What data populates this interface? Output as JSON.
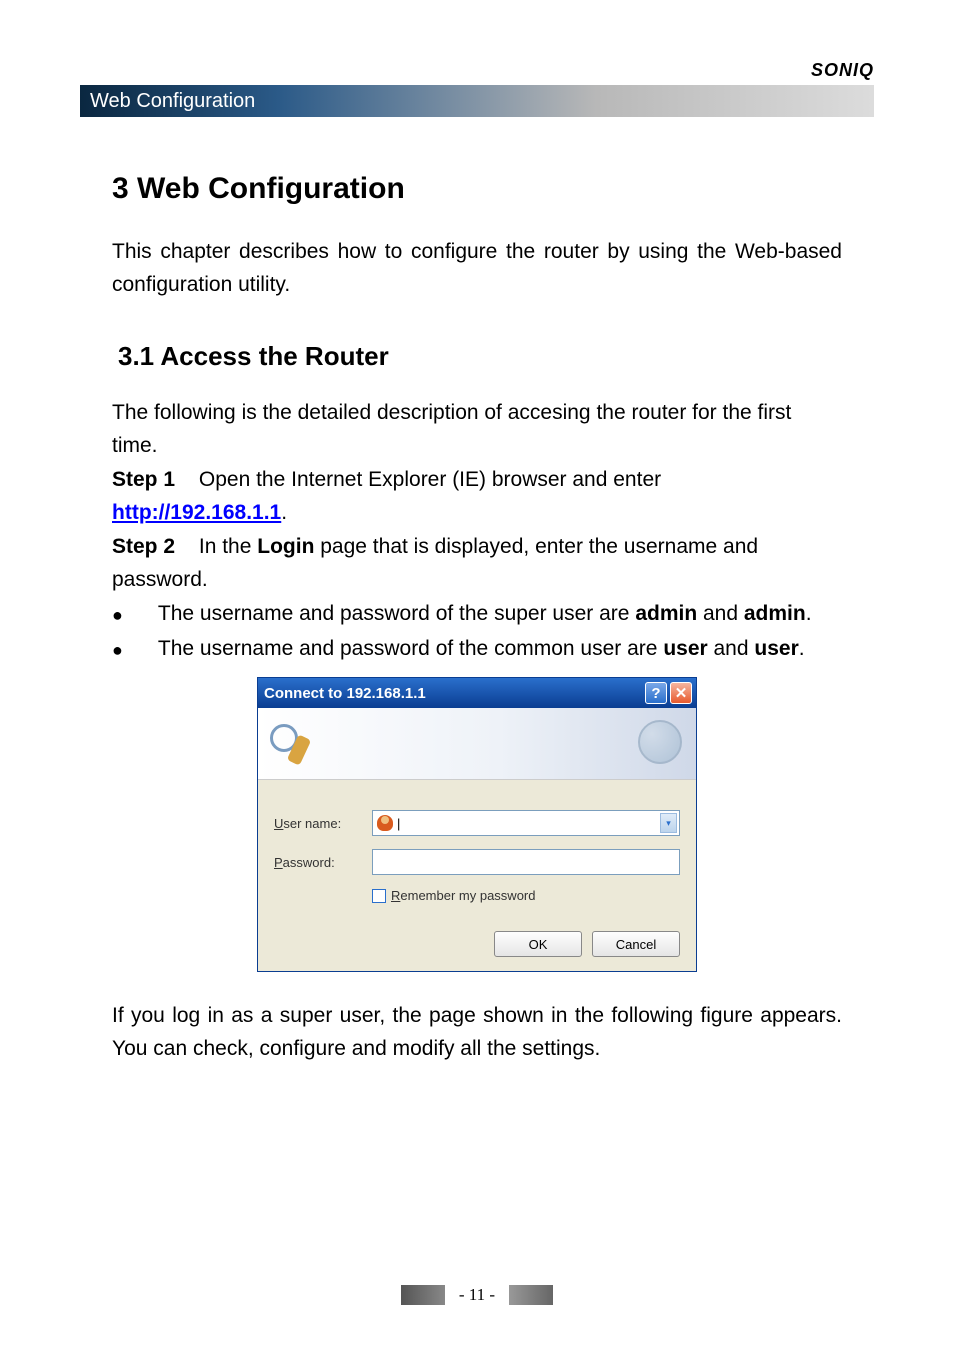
{
  "brand": "soniq",
  "header_tab": "Web Configuration",
  "heading": "3    Web Configuration",
  "intro": "This chapter describes how to configure the router by using the Web-based configuration utility.",
  "subheading": "3.1   Access the Router",
  "para1": "The following is the detailed description of accesing the router for the first time.",
  "step1_label": "Step 1",
  "step1_text_a": "Open the Internet Explorer (IE) browser and enter ",
  "step1_link": "http://192.168.1.1",
  "step1_text_b": ".",
  "step2_label": "Step 2",
  "step2_text_a": "In the ",
  "step2_bold": "Login",
  "step2_text_b": " page that is displayed, enter the username and password.",
  "bullet1_a": "The username and password of the super user are ",
  "bullet1_b1": "admin",
  "bullet1_c": " and ",
  "bullet1_b2": "admin",
  "bullet1_d": ".",
  "bullet2_a": "The username and password of the common user are ",
  "bullet2_b1": "user",
  "bullet2_c": " and ",
  "bullet2_b2": "user",
  "bullet2_d": ".",
  "dialog": {
    "title": "Connect to 192.168.1.1",
    "help": "?",
    "close": "✕",
    "username_label_u": "U",
    "username_label_rest": "ser name:",
    "password_label_u": "P",
    "password_label_rest": "assword:",
    "remember_u": "R",
    "remember_rest": "emember my password",
    "ok": "OK",
    "cancel": "Cancel",
    "caret": "▾"
  },
  "post": "If you log in as a super user, the page shown in the following figure appears. You can check, configure and modify all the settings.",
  "page_number": "- 11 -"
}
